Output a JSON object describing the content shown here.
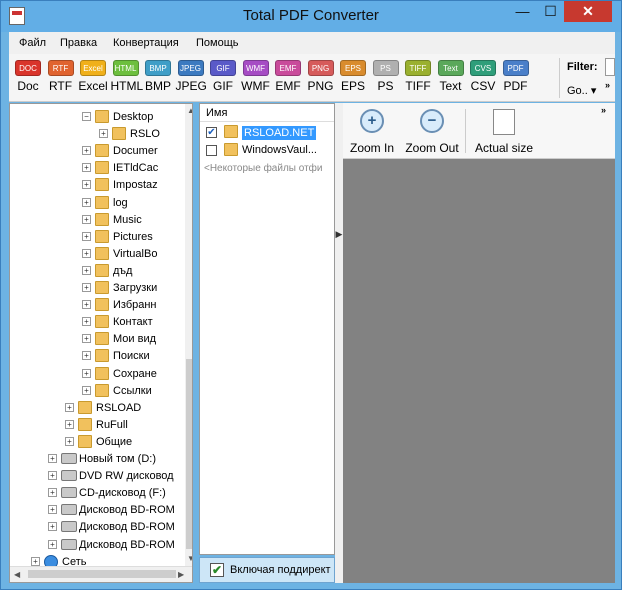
{
  "window": {
    "title": "Total PDF Converter",
    "controls": {
      "minimize": "—",
      "maximize": "☐",
      "close": "✕"
    }
  },
  "menu": [
    "Файл",
    "Правка",
    "Конвертация",
    "Помощь"
  ],
  "toolbar": {
    "formats": [
      {
        "icon": "DOC",
        "label": "Doc",
        "color": "#d9342b"
      },
      {
        "icon": "RTF",
        "label": "RTF",
        "color": "#e0632f"
      },
      {
        "icon": "Excel",
        "label": "Excel",
        "color": "#f0b01a"
      },
      {
        "icon": "HTML",
        "label": "HTML",
        "color": "#6dbf3e"
      },
      {
        "icon": "BMP",
        "label": "BMP",
        "color": "#3f9ec7"
      },
      {
        "icon": "JPEG",
        "label": "JPEG",
        "color": "#3c7ac0"
      },
      {
        "icon": "GIF",
        "label": "GIF",
        "color": "#5a5ac8"
      },
      {
        "icon": "WMF",
        "label": "WMF",
        "color": "#a64cc4"
      },
      {
        "icon": "EMF",
        "label": "EMF",
        "color": "#c94b9b"
      },
      {
        "icon": "PNG",
        "label": "PNG",
        "color": "#d65b5b"
      },
      {
        "icon": "EPS",
        "label": "EPS",
        "color": "#d98c2e"
      },
      {
        "icon": "PS",
        "label": "PS",
        "color": "#b0b0b0"
      },
      {
        "icon": "TIFF",
        "label": "TIFF",
        "color": "#9ab02f"
      },
      {
        "icon": "Text",
        "label": "Text",
        "color": "#5aa85a"
      },
      {
        "icon": "CVS",
        "label": "CSV",
        "color": "#2f9e7a"
      },
      {
        "icon": "PDF",
        "label": "PDF",
        "color": "#4a7fc9"
      }
    ],
    "filter_label": "Filter:",
    "go_label": "Go.. ▾",
    "more": "»"
  },
  "tree": {
    "nodes": [
      {
        "label": "Desktop",
        "depth": 3,
        "expander": "−",
        "icon": "folder"
      },
      {
        "label": "RSLO",
        "depth": 4,
        "expander": "+",
        "icon": "folder"
      },
      {
        "label": "Documer",
        "depth": 3,
        "expander": "+",
        "icon": "folder"
      },
      {
        "label": "IETldCac",
        "depth": 3,
        "expander": "+",
        "icon": "folder"
      },
      {
        "label": "Impostaz",
        "depth": 3,
        "expander": "+",
        "icon": "folder"
      },
      {
        "label": "log",
        "depth": 3,
        "expander": "+",
        "icon": "folder"
      },
      {
        "label": "Music",
        "depth": 3,
        "expander": "+",
        "icon": "folder"
      },
      {
        "label": "Pictures",
        "depth": 3,
        "expander": "+",
        "icon": "folder"
      },
      {
        "label": "VirtualBo",
        "depth": 3,
        "expander": "+",
        "icon": "folder"
      },
      {
        "label": "дъд",
        "depth": 3,
        "expander": "+",
        "icon": "folder"
      },
      {
        "label": "Загрузки",
        "depth": 3,
        "expander": "+",
        "icon": "folder"
      },
      {
        "label": "Избранн",
        "depth": 3,
        "expander": "+",
        "icon": "folder"
      },
      {
        "label": "Контакт",
        "depth": 3,
        "expander": "+",
        "icon": "folder"
      },
      {
        "label": "Мои вид",
        "depth": 3,
        "expander": "+",
        "icon": "folder"
      },
      {
        "label": "Поиски",
        "depth": 3,
        "expander": "+",
        "icon": "folder"
      },
      {
        "label": "Сохране",
        "depth": 3,
        "expander": "+",
        "icon": "folder"
      },
      {
        "label": "Ссылки",
        "depth": 3,
        "expander": "+",
        "icon": "folder"
      },
      {
        "label": "RSLOAD",
        "depth": 2,
        "expander": "+",
        "icon": "folder"
      },
      {
        "label": "RuFull",
        "depth": 2,
        "expander": "+",
        "icon": "folder"
      },
      {
        "label": "Общие",
        "depth": 2,
        "expander": "+",
        "icon": "folder"
      },
      {
        "label": "Новый том (D:)",
        "depth": 1,
        "expander": "+",
        "icon": "drive"
      },
      {
        "label": "DVD RW дисковод",
        "depth": 1,
        "expander": "+",
        "icon": "drive"
      },
      {
        "label": "CD-дисковод (F:)",
        "depth": 1,
        "expander": "+",
        "icon": "drive"
      },
      {
        "label": "Дисковод BD-ROM",
        "depth": 1,
        "expander": "+",
        "icon": "drive"
      },
      {
        "label": "Дисковод BD-ROM",
        "depth": 1,
        "expander": "+",
        "icon": "drive"
      },
      {
        "label": "Дисковод BD-ROM",
        "depth": 1,
        "expander": "+",
        "icon": "drive"
      },
      {
        "label": "Сеть",
        "depth": 0,
        "expander": "+",
        "icon": "network"
      }
    ]
  },
  "files": {
    "column_header": "Имя",
    "rows": [
      {
        "name": "RSLOAD.NET",
        "checked": true,
        "selected": true
      },
      {
        "name": "WindowsVaul...",
        "checked": false,
        "selected": false
      }
    ],
    "hint": "<Некоторые файлы отфи",
    "include_subdirs": "Включая поддирект"
  },
  "preview": {
    "zoom_in": "Zoom In",
    "zoom_out": "Zoom Out",
    "actual_size": "Actual size",
    "more": "»"
  }
}
